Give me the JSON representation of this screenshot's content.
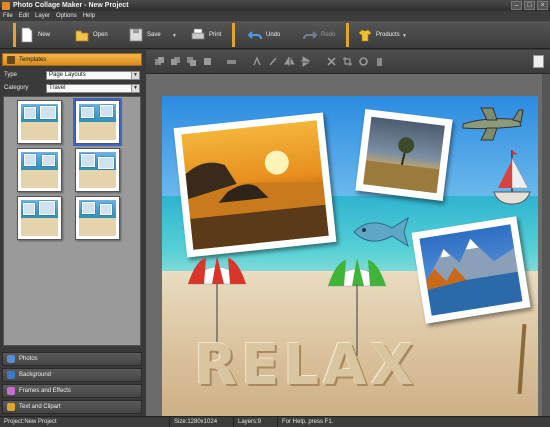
{
  "window": {
    "title": "Photo Collage Maker - New Project"
  },
  "menu": [
    "File",
    "Edit",
    "Layer",
    "Options",
    "Help"
  ],
  "toolbar": {
    "new": "New",
    "open": "Open",
    "save": "Save",
    "print": "Print",
    "undo": "Undo",
    "redo": "Redo",
    "products": "Products"
  },
  "panel": {
    "templates_header": "Templates",
    "type_label": "Type",
    "type_value": "Page Layouts",
    "category_label": "Category",
    "category_value": "Travel",
    "sections": [
      "Photos",
      "Background",
      "Frames and Effects",
      "Text and Clipart"
    ]
  },
  "canvas": {
    "sand_text": "RELAX"
  },
  "status": {
    "project": "Project:New Project",
    "size": "Size:1280x1024",
    "layers": "Layers:9",
    "help": "For Help, press F1."
  },
  "colors": {
    "accent": "#e0a52c",
    "selection": "#3a66c9"
  }
}
